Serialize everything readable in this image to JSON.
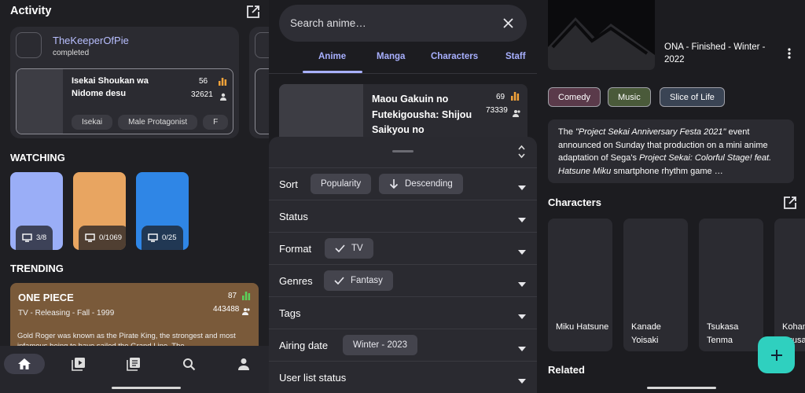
{
  "colors": {
    "accent": "#a8b0ff",
    "fab": "#2fd0bf",
    "trend_bar": "#5bd15b",
    "stat_bar": "#f2a33a"
  },
  "home": {
    "activity_title": "Activity",
    "activity": {
      "user_name": "TheKeeperOfPie",
      "action": "completed",
      "media_title": "Isekai Shoukan wa Nidome desu",
      "score": "56",
      "popularity": "32621",
      "tags": [
        "Isekai",
        "Male Protagonist",
        "F"
      ]
    },
    "watching_title": "WATCHING",
    "watching": [
      {
        "progress": "3/8",
        "color": "#9aaef7"
      },
      {
        "progress": "0/1069",
        "color": "#e8a561"
      },
      {
        "progress": "0/25",
        "color": "#2f86e6"
      }
    ],
    "trending_title": "TRENDING",
    "trending": {
      "title": "ONE PIECE",
      "meta": "TV - Releasing - Fall - 1999",
      "score": "87",
      "popularity": "443488",
      "description": "Gold Roger was known as the Pirate King, the strongest and most infamous being to have sailed the Grand Line. The"
    },
    "nav_items": [
      "home-icon",
      "anime-list-icon",
      "manga-list-icon",
      "search-icon",
      "profile-icon"
    ]
  },
  "search": {
    "placeholder": "Search anime…",
    "tabs": [
      "Anime",
      "Manga",
      "Characters",
      "Staff"
    ],
    "result": {
      "title": "Maou Gakuin no Futekigousha: Shijou Saikyou no",
      "score": "69",
      "popularity": "73339"
    },
    "filters": {
      "sort_label": "Sort",
      "sort_value": "Popularity",
      "sort_order": "Descending",
      "status_label": "Status",
      "format_label": "Format",
      "format_value": "TV",
      "genres_label": "Genres",
      "genres_value": "Fantasy",
      "tags_label": "Tags",
      "airing_label": "Airing date",
      "airing_value": "Winter - 2023",
      "user_list_label": "User list status"
    }
  },
  "details": {
    "meta": "ONA - Finished - Winter - 2022",
    "genres": [
      {
        "label": "Comedy",
        "color": "#5a3a4a"
      },
      {
        "label": "Music",
        "color": "#4a5a3a"
      },
      {
        "label": "Slice of Life",
        "color": "#3a4454"
      }
    ],
    "description_pre": "The ",
    "description_italic": "\"Project Sekai Anniversary Festa 2021\"",
    "description_mid": " event announced on Sunday that production on a mini anime adaptation of Sega's ",
    "description_italic2": "Project Sekai: Colorful Stage! feat. Hatsune Miku",
    "description_post": " smartphone rhythm game …",
    "characters_title": "Characters",
    "characters": [
      "Miku Hatsune",
      "Kanade Yoisaki",
      "Tsukasa Tenma",
      "Kohane Azusawa"
    ],
    "related_title": "Related"
  }
}
